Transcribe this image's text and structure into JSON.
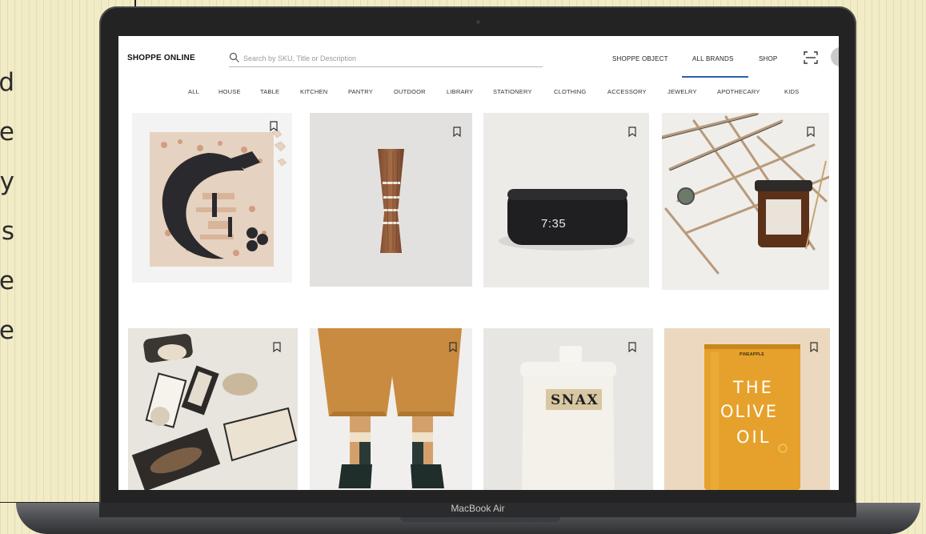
{
  "side_text": {
    "letters": [
      "d",
      "e",
      "y",
      "s",
      "e",
      "e"
    ]
  },
  "device": {
    "label": "MacBook Air"
  },
  "header": {
    "brand": "SHOPPE ONLINE",
    "search_placeholder": "Search by SKU, Title or Description",
    "nav": [
      "SHOPPE OBJECT",
      "ALL BRANDS",
      "SHOP"
    ],
    "active_nav": "ALL BRANDS",
    "accent_color": "#2f5fa8"
  },
  "categories": [
    "ALL",
    "HOUSE",
    "TABLE",
    "KITCHEN",
    "PANTRY",
    "OUTDOOR",
    "LIBRARY",
    "STATIONERY",
    "CLOTHING",
    "ACCESSORY",
    "JEWELRY",
    "APOTHECARY",
    "KIDS"
  ],
  "products": {
    "clock_time": "7:35",
    "jar_label": "SNAX",
    "oil_small_label": "PINEAPPLE",
    "oil_line1": "THE",
    "oil_line2": "OLIVE",
    "oil_line3": "OIL"
  }
}
